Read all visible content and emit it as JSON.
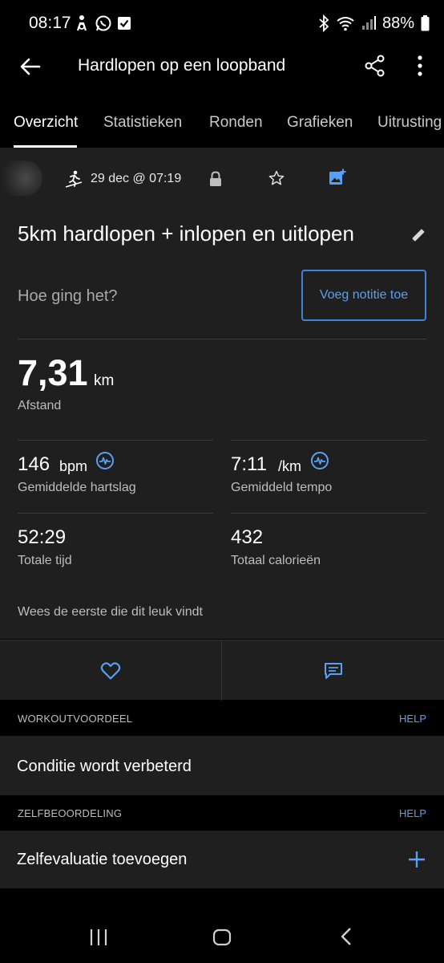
{
  "status_bar": {
    "time": "08:17",
    "battery": "88%"
  },
  "app_bar": {
    "title": "Hardlopen op een loopband"
  },
  "tabs": [
    {
      "label": "Overzicht",
      "active": true
    },
    {
      "label": "Statistieken",
      "active": false
    },
    {
      "label": "Ronden",
      "active": false
    },
    {
      "label": "Grafieken",
      "active": false
    },
    {
      "label": "Uitrusting",
      "active": false
    }
  ],
  "activity": {
    "date": "29 dec @ 07:19",
    "name": "5km hardlopen + inlopen en uitlopen",
    "how_label": "Hoe ging het?",
    "note_button": "Voeg notitie toe"
  },
  "stats": {
    "distance": {
      "value": "7,31",
      "unit": "km",
      "label": "Afstand"
    },
    "heart_rate": {
      "value": "146",
      "unit": "bpm",
      "label": "Gemiddelde hartslag"
    },
    "pace": {
      "value": "7:11",
      "unit": "/km",
      "label": "Gemiddeld tempo"
    },
    "total_time": {
      "value": "52:29",
      "label": "Totale tijd"
    },
    "calories": {
      "value": "432",
      "label": "Totaal calorieën"
    }
  },
  "likes_text": "Wees de eerste die dit leuk vindt",
  "sections": [
    {
      "title": "WORKOUTVOORDEEL",
      "help": "HELP",
      "content": "Conditie wordt verbeterd"
    },
    {
      "title": "ZELFBEOORDELING",
      "help": "HELP",
      "content": "Zelfevaluatie toevoegen"
    }
  ],
  "colors": {
    "accent": "#5aa0f2",
    "card_background": "#1f1f1f",
    "page_background": "#000000"
  }
}
